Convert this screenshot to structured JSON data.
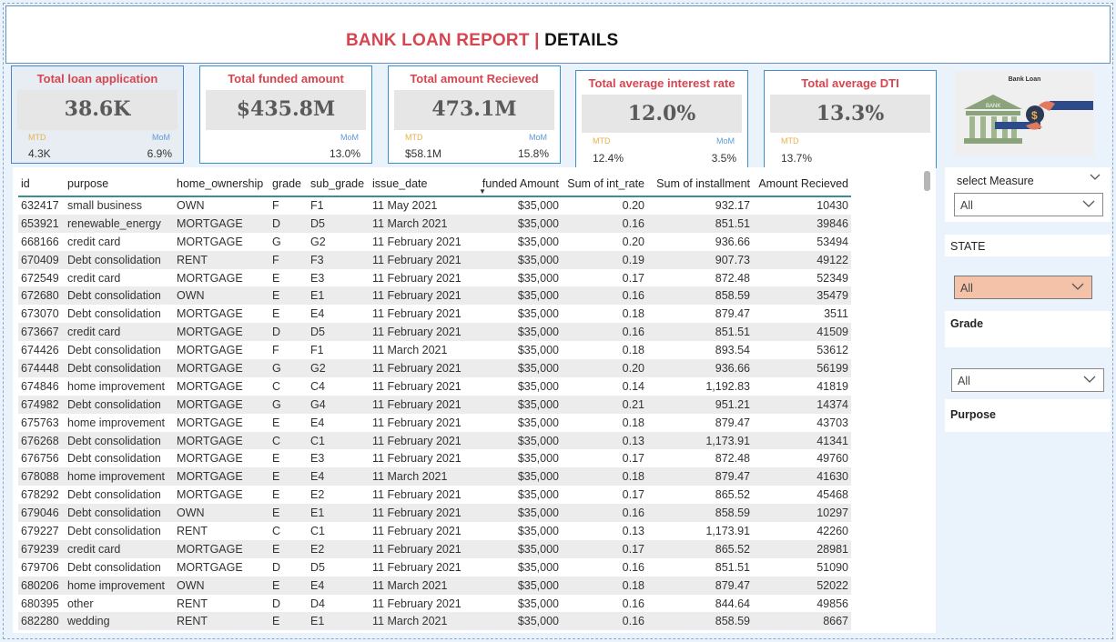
{
  "title": {
    "part1": "BANK LOAN REPORT |",
    "part2": "DETAILS"
  },
  "kpis": [
    {
      "title": "Total loan application",
      "value": "38.6K",
      "mtd_label": "MTD",
      "mtd_value": "4.3K",
      "mom_label": "MoM",
      "mom_value": "6.9%"
    },
    {
      "title": "Total funded amount",
      "value": "$435.8M",
      "mom_label": "MoM",
      "mom_value": "13.0%"
    },
    {
      "title": "Total amount Recieved",
      "value": "473.1M",
      "mtd_label": "MTD",
      "mtd_value": "$58.1M",
      "mom_label": "MoM",
      "mom_value": "15.8%"
    },
    {
      "title": "Total average interest rate",
      "value": "12.0%",
      "mtd_label": "MTD",
      "mtd_value": "12.4%",
      "mom_label": "MoM",
      "mom_value": "3.5%"
    },
    {
      "title": "Total average DTI",
      "value": "13.3%",
      "mtd_label": "MTD",
      "mtd_value": "13.7%"
    }
  ],
  "logo": {
    "title": "Bank Loan",
    "bank_text": "BANK",
    "dollar": "$"
  },
  "table": {
    "columns": [
      "id",
      "purpose",
      "home_ownership",
      "grade",
      "sub_grade",
      "issue_date",
      "funded Amount",
      "Sum of int_rate",
      "Sum of installment",
      "Amount Recieved"
    ],
    "rows": [
      [
        "632417",
        "small business",
        "OWN",
        "F",
        "F1",
        "11 May 2021",
        "$35,000",
        "0.20",
        "932.17",
        "10430"
      ],
      [
        "653921",
        "renewable_energy",
        "MORTGAGE",
        "D",
        "D5",
        "11 March 2021",
        "$35,000",
        "0.16",
        "851.51",
        "39846"
      ],
      [
        "668166",
        "credit card",
        "MORTGAGE",
        "G",
        "G2",
        "11 February 2021",
        "$35,000",
        "0.20",
        "936.66",
        "53494"
      ],
      [
        "670409",
        "Debt consolidation",
        "RENT",
        "F",
        "F3",
        "11 February 2021",
        "$35,000",
        "0.19",
        "907.73",
        "49122"
      ],
      [
        "672549",
        "credit card",
        "MORTGAGE",
        "E",
        "E3",
        "11 February 2021",
        "$35,000",
        "0.17",
        "872.48",
        "52349"
      ],
      [
        "672680",
        "Debt consolidation",
        "OWN",
        "E",
        "E1",
        "11 February 2021",
        "$35,000",
        "0.16",
        "858.59",
        "35479"
      ],
      [
        "673070",
        "Debt consolidation",
        "MORTGAGE",
        "E",
        "E4",
        "11 February 2021",
        "$35,000",
        "0.18",
        "879.47",
        "3511"
      ],
      [
        "673667",
        "credit card",
        "MORTGAGE",
        "D",
        "D5",
        "11 February 2021",
        "$35,000",
        "0.16",
        "851.51",
        "41509"
      ],
      [
        "674426",
        "Debt consolidation",
        "MORTGAGE",
        "F",
        "F1",
        "11 March 2021",
        "$35,000",
        "0.18",
        "893.54",
        "53612"
      ],
      [
        "674448",
        "Debt consolidation",
        "MORTGAGE",
        "G",
        "G2",
        "11 February 2021",
        "$35,000",
        "0.20",
        "936.66",
        "56199"
      ],
      [
        "674846",
        "home improvement",
        "MORTGAGE",
        "C",
        "C4",
        "11 February 2021",
        "$35,000",
        "0.14",
        "1,192.83",
        "41819"
      ],
      [
        "674982",
        "Debt consolidation",
        "MORTGAGE",
        "G",
        "G4",
        "11 February 2021",
        "$35,000",
        "0.21",
        "951.21",
        "14374"
      ],
      [
        "675763",
        "home improvement",
        "MORTGAGE",
        "E",
        "E4",
        "11 February 2021",
        "$35,000",
        "0.18",
        "879.47",
        "43703"
      ],
      [
        "676268",
        "Debt consolidation",
        "MORTGAGE",
        "C",
        "C1",
        "11 February 2021",
        "$35,000",
        "0.13",
        "1,173.91",
        "41341"
      ],
      [
        "676756",
        "Debt consolidation",
        "MORTGAGE",
        "E",
        "E3",
        "11 February 2021",
        "$35,000",
        "0.17",
        "872.48",
        "49760"
      ],
      [
        "678088",
        "home improvement",
        "MORTGAGE",
        "E",
        "E4",
        "11 March 2021",
        "$35,000",
        "0.18",
        "879.47",
        "41630"
      ],
      [
        "678292",
        "Debt consolidation",
        "MORTGAGE",
        "E",
        "E2",
        "11 February 2021",
        "$35,000",
        "0.17",
        "865.52",
        "45468"
      ],
      [
        "679046",
        "Debt consolidation",
        "OWN",
        "E",
        "E1",
        "11 February 2021",
        "$35,000",
        "0.16",
        "858.59",
        "10297"
      ],
      [
        "679227",
        "Debt consolidation",
        "RENT",
        "C",
        "C1",
        "11 February 2021",
        "$35,000",
        "0.13",
        "1,173.91",
        "42260"
      ],
      [
        "679239",
        "credit card",
        "MORTGAGE",
        "E",
        "E2",
        "11 February 2021",
        "$35,000",
        "0.17",
        "865.52",
        "28981"
      ],
      [
        "679706",
        "Debt consolidation",
        "MORTGAGE",
        "D",
        "D5",
        "11 February 2021",
        "$35,000",
        "0.16",
        "851.51",
        "51090"
      ],
      [
        "680206",
        "home improvement",
        "OWN",
        "E",
        "E4",
        "11 March 2021",
        "$35,000",
        "0.18",
        "879.47",
        "52022"
      ],
      [
        "680395",
        "other",
        "RENT",
        "D",
        "D4",
        "11 February 2021",
        "$35,000",
        "0.16",
        "844.64",
        "49856"
      ],
      [
        "682280",
        "wedding",
        "RENT",
        "E",
        "E1",
        "11 March 2021",
        "$35,000",
        "0.16",
        "858.59",
        "8667"
      ]
    ]
  },
  "slicers": {
    "measure": {
      "title": "select Measure",
      "value": "All"
    },
    "state": {
      "title": "STATE",
      "value": "All"
    },
    "grade": {
      "title": "Grade",
      "value": "All"
    },
    "purpose": {
      "title": "Purpose"
    }
  },
  "colors": {
    "accent_red": "#d64550",
    "mtd": "#e8b14a",
    "mom": "#5e9bd6",
    "state_dropdown": "#f4c2a8"
  }
}
